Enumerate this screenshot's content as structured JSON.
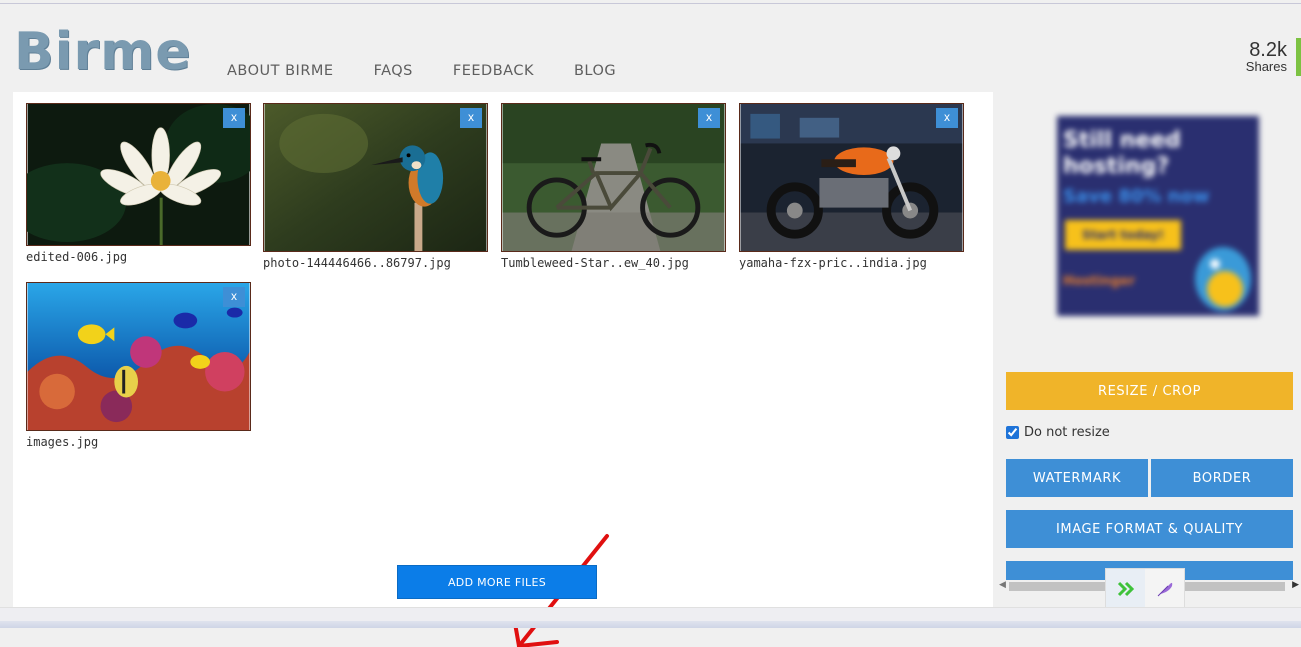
{
  "header": {
    "logo": "Birme",
    "nav": [
      "ABOUT BIRME",
      "FAQS",
      "FEEDBACK",
      "BLOG"
    ],
    "shares_count": "8.2k",
    "shares_label": "Shares"
  },
  "files": [
    {
      "name": "edited-006.jpg",
      "remove": "x"
    },
    {
      "name": "photo-144446466..86797.jpg",
      "remove": "x"
    },
    {
      "name": "Tumbleweed-Star..ew_40.jpg",
      "remove": "x"
    },
    {
      "name": "yamaha-fzx-pric..india.jpg",
      "remove": "x"
    },
    {
      "name": "images.jpg",
      "remove": "x"
    }
  ],
  "add_more": "ADD MORE FILES",
  "sidebar": {
    "ad": {
      "headline": "Still need hosting?",
      "offer": "Save 80% now",
      "cta": "Start today!",
      "brand": "Hostinger"
    },
    "resize_crop": "RESIZE / CROP",
    "do_not_resize": "Do not resize",
    "do_not_resize_checked": true,
    "watermark": "WATERMARK",
    "border": "BORDER",
    "image_format": "IMAGE FORMAT & QUALITY"
  },
  "colors": {
    "accent_blue": "#3e8fd6",
    "add_button": "#0b7de8",
    "resize_yellow": "#f0b429",
    "logo": "#7a9ab0",
    "annotation_arrow": "#e01010"
  }
}
